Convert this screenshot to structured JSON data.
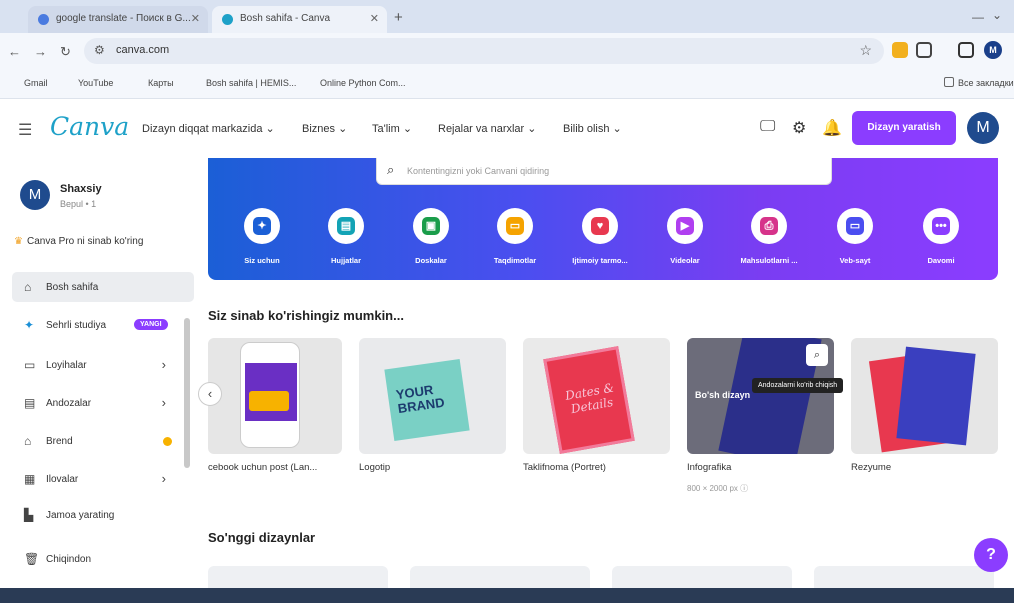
{
  "browser": {
    "tabs": [
      {
        "label": "google translate - Поиск в G..."
      },
      {
        "label": "Bosh sahifa - Canva"
      }
    ],
    "new_tab": "+",
    "url": "canva.com",
    "bookmarks": [
      {
        "label": "Gmail",
        "color": "#ea4335"
      },
      {
        "label": "YouTube",
        "color": "#ff0000"
      },
      {
        "label": "Карты",
        "color": "#34a853"
      },
      {
        "label": "Bosh sahifa | HEMIS...",
        "color": "#f2b01e"
      },
      {
        "label": "Online Python Com...",
        "color": "#7b3fbf"
      }
    ],
    "other_bookmarks": "Все закладки"
  },
  "header": {
    "logo": "Canva",
    "nav": [
      {
        "label": "Dizayn diqqat markazida"
      },
      {
        "label": "Biznes"
      },
      {
        "label": "Ta'lim"
      },
      {
        "label": "Rejalar va narxlar"
      },
      {
        "label": "Bilib olish"
      }
    ],
    "create_button": "Dizayn yaratish",
    "avatar_letter": "M",
    "accent": "#8b3dff"
  },
  "sidebar": {
    "avatar_letter": "M",
    "name": "Shaxsiy",
    "sub": "Bepul • 1",
    "pro_offer": "Canva Pro ni sinab ko'ring",
    "items": [
      {
        "label": "Bosh sahifa",
        "icon": "home-icon"
      },
      {
        "label": "Sehrli studiya",
        "icon": "magic-icon",
        "badge": "YANGI"
      },
      {
        "label": "Loyihalar",
        "icon": "folder-icon"
      },
      {
        "label": "Andozalar",
        "icon": "template-icon"
      },
      {
        "label": "Brend",
        "icon": "brand-icon"
      },
      {
        "label": "Ilovalar",
        "icon": "apps-icon"
      },
      {
        "label": "Jamoa yarating",
        "icon": "team-icon"
      },
      {
        "label": "Chiqindon",
        "icon": "trash-icon"
      }
    ]
  },
  "search": {
    "placeholder": "Kontentingizni yoki Canvani qidiring"
  },
  "categories": [
    {
      "label": "Siz uchun",
      "color": "#1b5fd6"
    },
    {
      "label": "Hujjatlar",
      "color": "#13a3b5"
    },
    {
      "label": "Doskalar",
      "color": "#1a9d4a"
    },
    {
      "label": "Taqdimotlar",
      "color": "#f5a300"
    },
    {
      "label": "Ijtimoiy tarmo...",
      "color": "#e8384f"
    },
    {
      "label": "Videolar",
      "color": "#b03ff0"
    },
    {
      "label": "Mahsulotlarni ...",
      "color": "#d6338a"
    },
    {
      "label": "Veb-sayt",
      "color": "#4b4ef0"
    },
    {
      "label": "Davomi",
      "color": "#8b3dff"
    }
  ],
  "section1": {
    "title": "Siz sinab ko'rishingiz mumkin..."
  },
  "templates": [
    {
      "label": "cebook uchun post (Lan...",
      "sub": ""
    },
    {
      "label": "Logotip",
      "sub": "",
      "card_text1": "YOUR",
      "card_text2": "BRAND"
    },
    {
      "label": "Taklifnoma (Portret)",
      "sub": "",
      "card_text": "Dates & Details"
    },
    {
      "label": "Infografika",
      "sub": "800 × 2000 px",
      "card_text": "Bo'sh dizayn"
    },
    {
      "label": "Rezyume",
      "sub": ""
    }
  ],
  "tooltip": "Andozalarni ko'rib chiqish",
  "section2": {
    "title": "So'nggi dizaynlar"
  },
  "help_label": "?"
}
